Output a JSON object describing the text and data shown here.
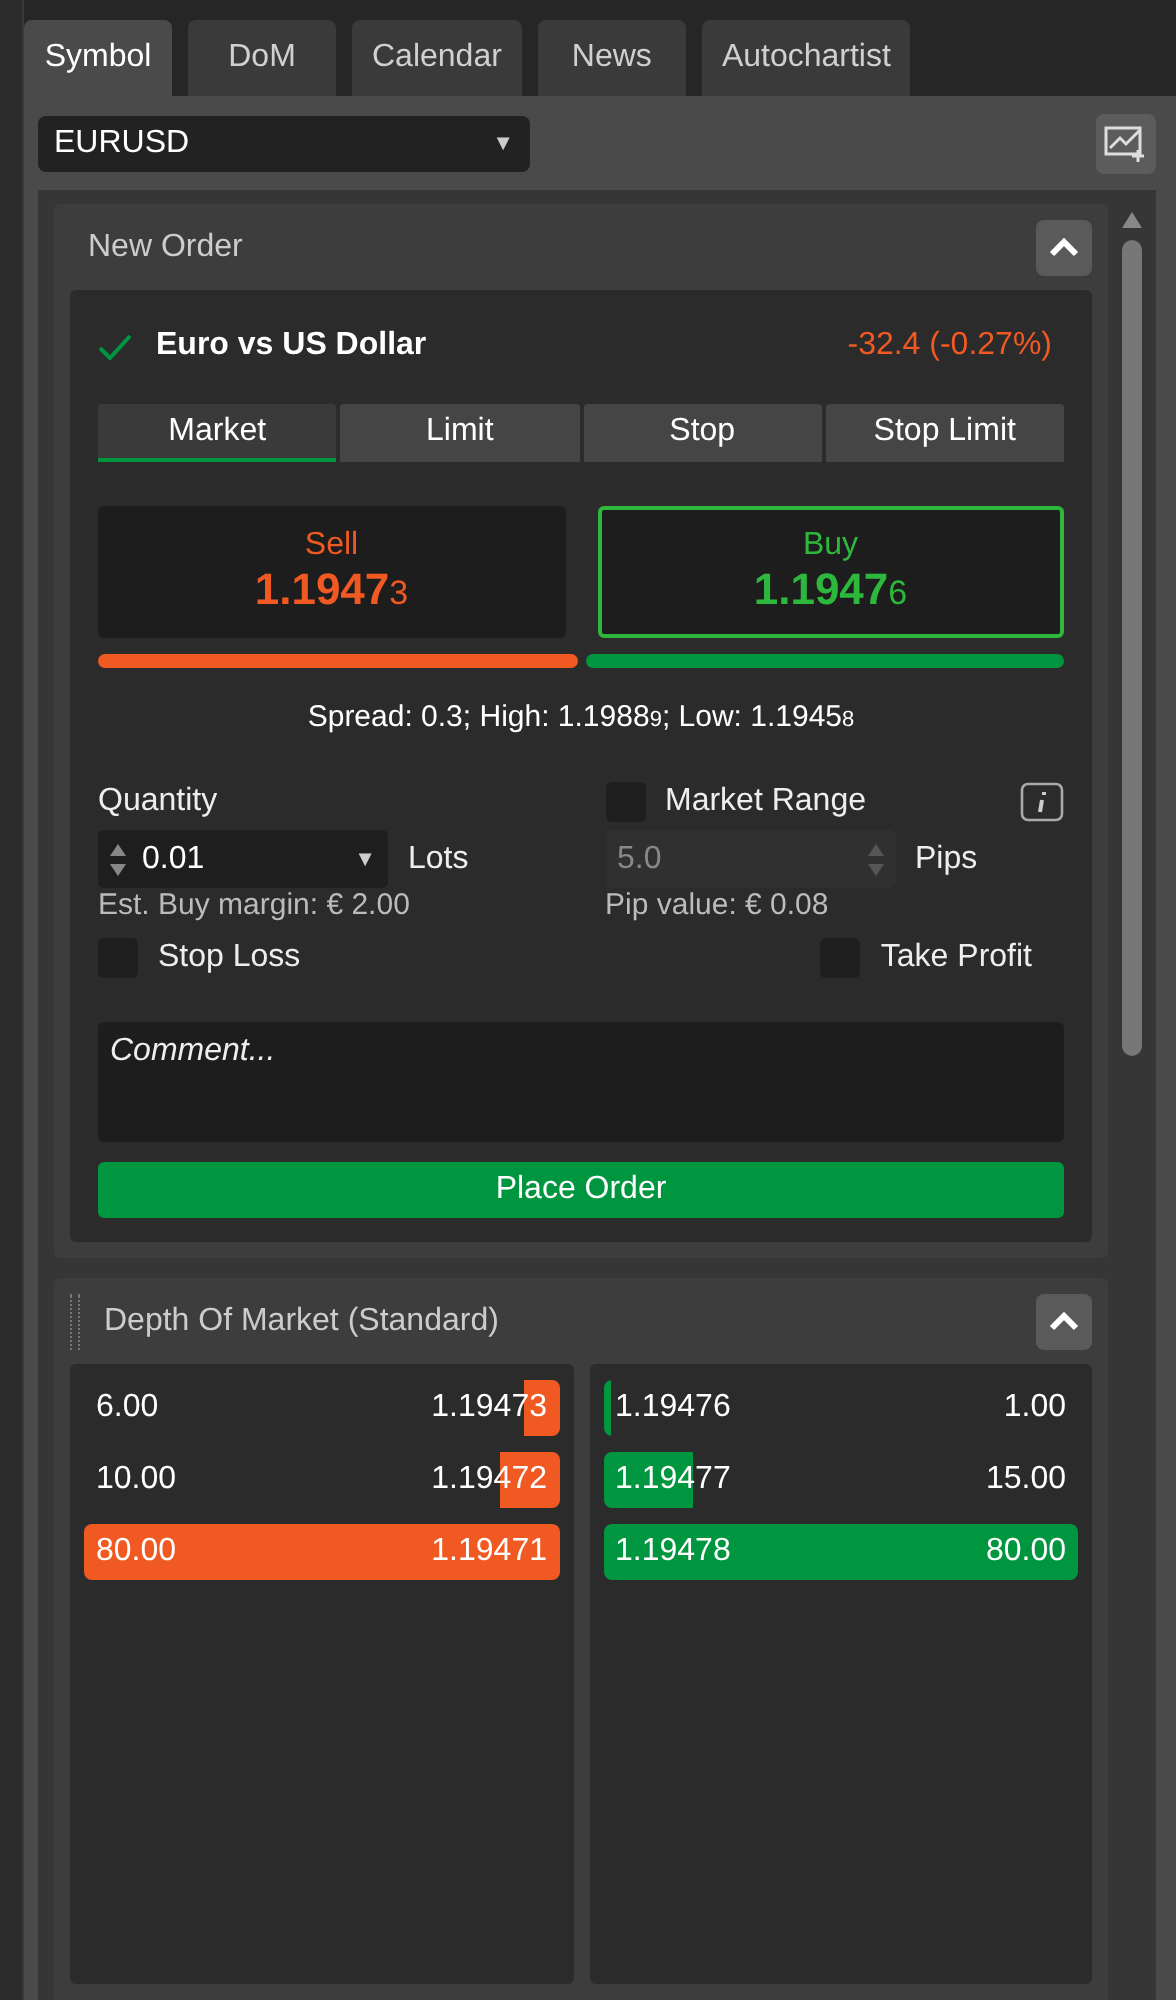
{
  "tabs": [
    {
      "label": "Symbol",
      "selected": true
    },
    {
      "label": "DoM",
      "selected": false
    },
    {
      "label": "Calendar",
      "selected": false
    },
    {
      "label": "News",
      "selected": false
    },
    {
      "label": "Autochartist",
      "selected": false
    }
  ],
  "symbol_select": {
    "value": "EURUSD",
    "caret": "▼"
  },
  "new_order": {
    "title": "New Order",
    "instrument": "Euro vs US Dollar",
    "change": "-32.4 (-0.27%)",
    "order_types": [
      {
        "label": "Market",
        "selected": true
      },
      {
        "label": "Limit",
        "selected": false
      },
      {
        "label": "Stop",
        "selected": false
      },
      {
        "label": "Stop Limit",
        "selected": false
      }
    ],
    "sides": [
      {
        "kind": "sell",
        "label": "Sell",
        "price": "1.1947",
        "pip": "3",
        "selected": false
      },
      {
        "kind": "buy",
        "label": "Buy",
        "price": "1.1947",
        "pip": "6",
        "selected": true
      }
    ],
    "spread": "Spread: 0.3; High: 1.1988$_{9}$; Low: 1.1945$_{8}$",
    "quantity": {
      "label": "Quantity",
      "value": "0.01",
      "caret": "▼",
      "unit": "Lots",
      "margin": "Est. Buy margin: € 2.00"
    },
    "market_range": {
      "label": "Market Range",
      "checked": false,
      "value": "5.0",
      "disabled": true,
      "unit": "Pips",
      "pip_value": "Pip value: € 0.08"
    },
    "stop_loss": {
      "label": "Stop Loss",
      "checked": false
    },
    "take_profit": {
      "label": "Take Profit",
      "checked": false
    },
    "comment": {
      "placeholder": "Comment..."
    },
    "place_order": "Place Order"
  },
  "depth_of_market": {
    "title": "Depth Of Market (Standard)",
    "sell": [
      {
        "volume": "6.00",
        "price": "1.19473"
      },
      {
        "volume": "10.00",
        "price": "1.19472"
      },
      {
        "volume": "80.00",
        "price": "1.19471"
      }
    ],
    "buy": [
      {
        "price": "1.19476",
        "volume": "1.00"
      },
      {
        "price": "1.19477",
        "volume": "15.00"
      },
      {
        "price": "1.19478",
        "volume": "80.00"
      }
    ]
  }
}
